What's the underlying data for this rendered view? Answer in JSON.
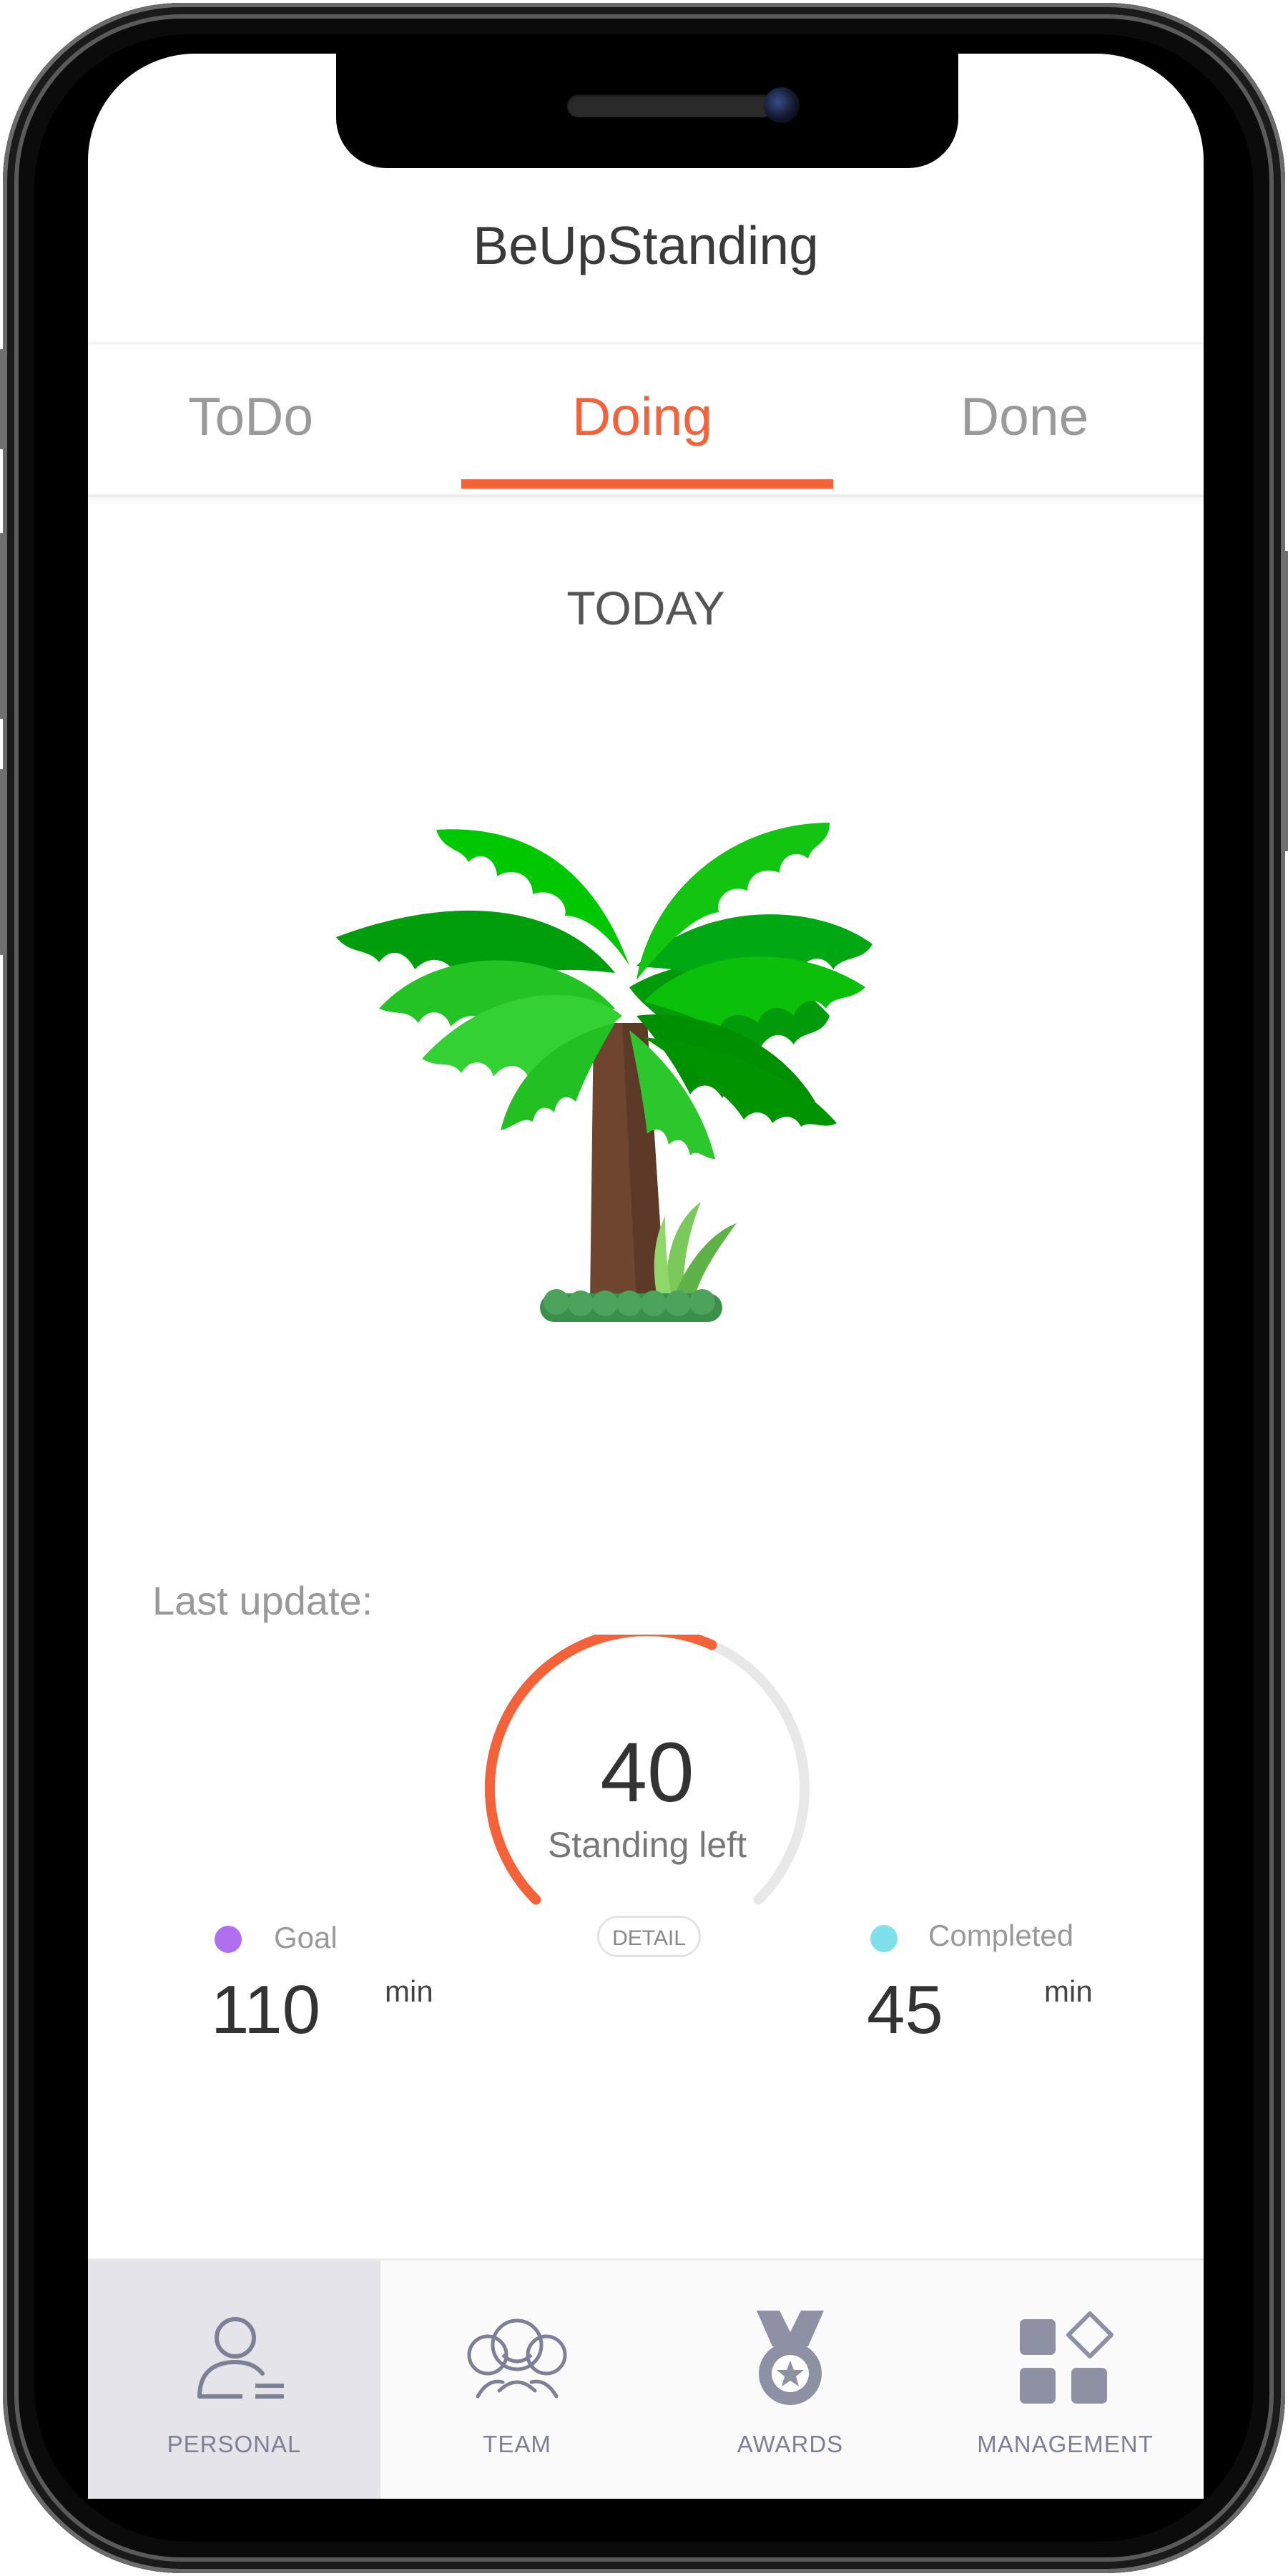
{
  "app": {
    "title": "BeUpStanding"
  },
  "tabs": [
    {
      "label": "ToDo",
      "active": false
    },
    {
      "label": "Doing",
      "active": true
    },
    {
      "label": "Done",
      "active": false
    }
  ],
  "main": {
    "day_label": "TODAY",
    "illustration": "palm-tree",
    "last_update_label": "Last update:",
    "ring": {
      "value": "40",
      "label": "Standing left",
      "detail_label": "DETAIL",
      "progress_fraction": 0.59
    },
    "goal": {
      "label": "Goal",
      "value": "110",
      "unit": "min",
      "color": "#b16ff0"
    },
    "completed": {
      "label": "Completed",
      "value": "45",
      "unit": "min",
      "color": "#7fe0ec"
    }
  },
  "bottom_nav": [
    {
      "label": "PERSONAL",
      "icon": "person-list-icon",
      "active": true
    },
    {
      "label": "TEAM",
      "icon": "team-icon",
      "active": false
    },
    {
      "label": "AWARDS",
      "icon": "medal-icon",
      "active": false
    },
    {
      "label": "MANAGEMENT",
      "icon": "grid-diamond-icon",
      "active": false
    }
  ],
  "colors": {
    "accent": "#f4623a",
    "ring_track": "#e8e8e8",
    "nav_text": "#7e8196"
  }
}
